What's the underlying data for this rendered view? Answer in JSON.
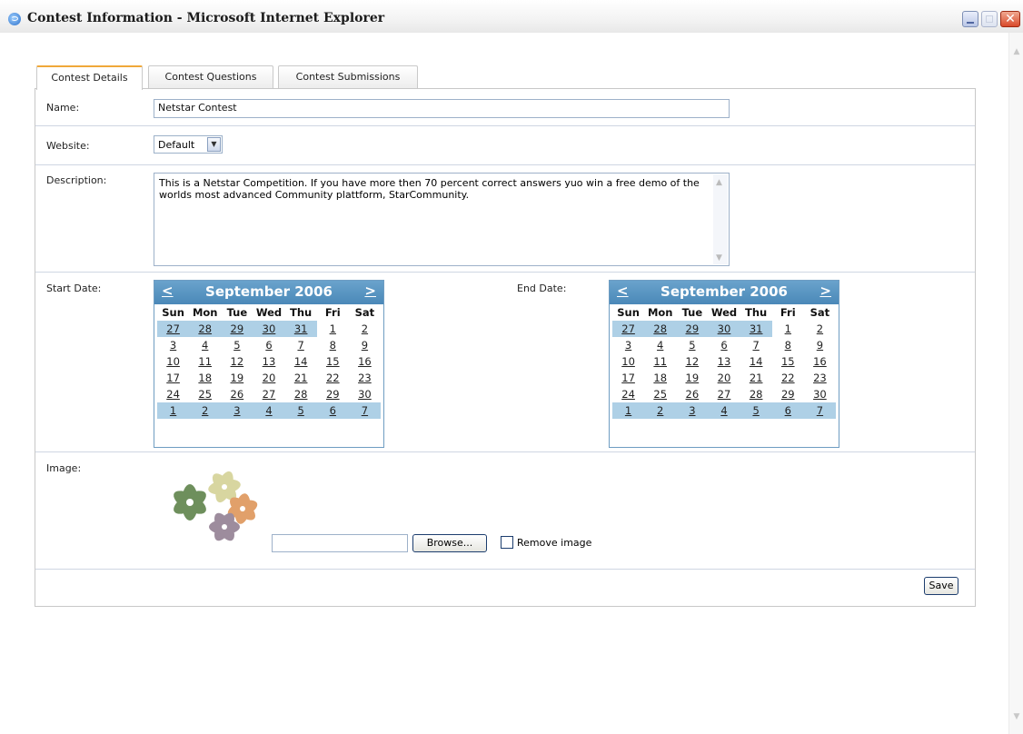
{
  "window": {
    "title": "Contest Information - Microsoft Internet Explorer"
  },
  "tabs": [
    {
      "label": "Contest Details"
    },
    {
      "label": "Contest Questions"
    },
    {
      "label": "Contest Submissions"
    }
  ],
  "form": {
    "name_label": "Name:",
    "name_value": "Netstar Contest",
    "website_label": "Website:",
    "website_value": "Default",
    "description_label": "Description:",
    "description_value": "This is a Netstar Competition. If you have more then 70 percent correct answers yuo win a free demo of the worlds most advanced Community plattform, StarCommunity.",
    "start_label": "Start Date:",
    "end_label": "End Date:",
    "image_label": "Image:",
    "browse_label": "Browse...",
    "remove_image_label": "Remove image",
    "save_label": "Save"
  },
  "calendars": [
    {
      "prev": "<",
      "next": ">",
      "month": "September 2006",
      "weekdays": [
        "Sun",
        "Mon",
        "Tue",
        "Wed",
        "Thu",
        "Fri",
        "Sat"
      ],
      "weeks": [
        [
          "27",
          "28",
          "29",
          "30",
          "31",
          "1",
          "2"
        ],
        [
          "3",
          "4",
          "5",
          "6",
          "7",
          "8",
          "9"
        ],
        [
          "10",
          "11",
          "12",
          "13",
          "14",
          "15",
          "16"
        ],
        [
          "17",
          "18",
          "19",
          "20",
          "21",
          "22",
          "23"
        ],
        [
          "24",
          "25",
          "26",
          "27",
          "28",
          "29",
          "30"
        ],
        [
          "1",
          "2",
          "3",
          "4",
          "5",
          "6",
          "7"
        ]
      ]
    },
    {
      "prev": "<",
      "next": ">",
      "month": "September 2006",
      "weekdays": [
        "Sun",
        "Mon",
        "Tue",
        "Wed",
        "Thu",
        "Fri",
        "Sat"
      ],
      "weeks": [
        [
          "27",
          "28",
          "29",
          "30",
          "31",
          "1",
          "2"
        ],
        [
          "3",
          "4",
          "5",
          "6",
          "7",
          "8",
          "9"
        ],
        [
          "10",
          "11",
          "12",
          "13",
          "14",
          "15",
          "16"
        ],
        [
          "17",
          "18",
          "19",
          "20",
          "21",
          "22",
          "23"
        ],
        [
          "24",
          "25",
          "26",
          "27",
          "28",
          "29",
          "30"
        ],
        [
          "1",
          "2",
          "3",
          "4",
          "5",
          "6",
          "7"
        ]
      ]
    }
  ],
  "colors": {
    "calendar_header": "#4a88b8",
    "other_month_cell": "#aed0e6",
    "active_tab_accent": "#f0a83a"
  }
}
